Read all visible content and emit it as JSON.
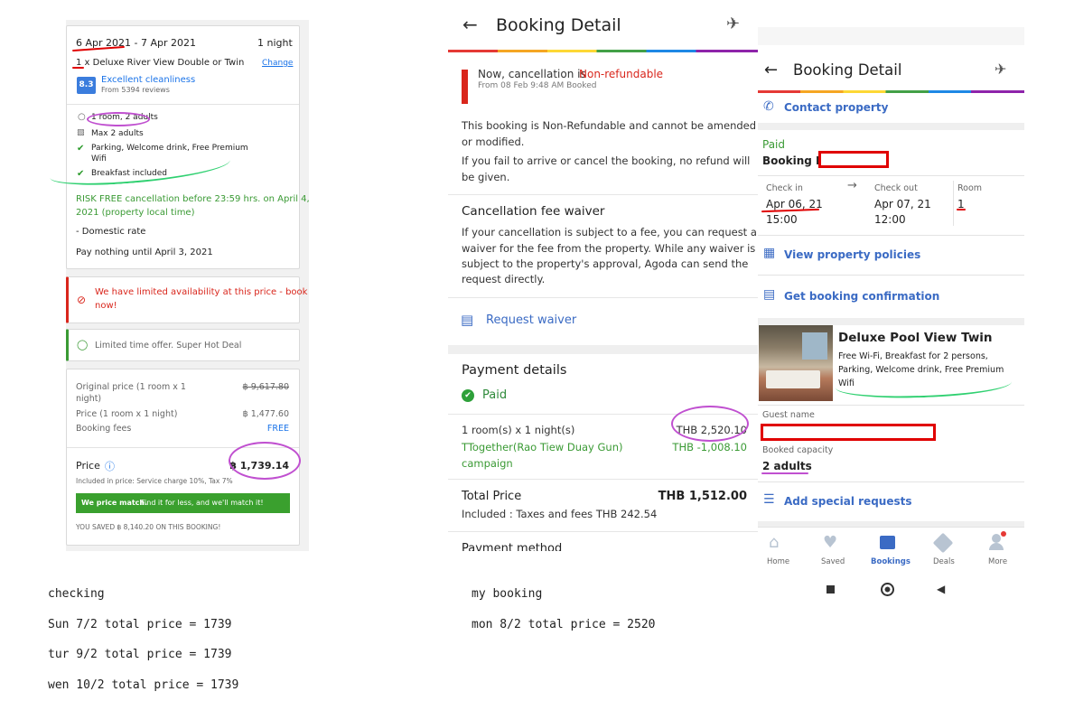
{
  "left": {
    "dates": "6 Apr 2021 - 7 Apr 2021",
    "nights": "1 night",
    "room_line": "1 x Deluxe River View Double or Twin",
    "change": "Change",
    "rating_score": "8.3",
    "rating_label": "Excellent cleanliness",
    "rating_reviews": "From 5394 reviews",
    "room_adults": "1 room, 2 adults",
    "max_adults": "Max 2 adults",
    "amenity1": "Parking, Welcome drink, Free Premium",
    "amenity1b": "Wifi",
    "amenity2": "Breakfast included",
    "cancel1": "RISK FREE cancellation before 23:59 hrs. on April 4,",
    "cancel2": "2021 (property local time)",
    "domestic": "- Domestic rate",
    "pay_nothing": "Pay nothing until April 3, 2021",
    "limited1": "We have limited availability at this price - book",
    "limited2": "now!",
    "offer": "Limited time offer. Super Hot Deal",
    "orig_label1": "Original price (1 room x 1",
    "orig_label2": "night)",
    "orig_value": "฿ 9,617.80",
    "price_label": "Price (1 room x 1 night)",
    "price_value": "฿ 1,477.60",
    "fees_label": "Booking fees",
    "fees_value": "FREE",
    "total_label": "Price",
    "total_value": "฿ 1,739.14",
    "included": "Included in price: Service charge 10%, Tax 7%",
    "match_bold": "We price match.",
    "match_rest": " Find it for less, and we'll match it!",
    "saved": "YOU SAVED ฿ 8,140.20 ON THIS BOOKING!"
  },
  "mid": {
    "title": "Booking Detail",
    "cancel_now": "Now, cancellation is ",
    "cancel_status": "Non-refundable",
    "cancel_from": "From 08 Feb 9:48 AM Booked",
    "nonref1": "This booking is Non-Refundable and cannot be amended",
    "nonref2": "or modified.",
    "nonref3": "If you fail to arrive or cancel the booking, no refund will",
    "nonref4": "be given.",
    "waiver_title": "Cancellation fee waiver",
    "waiver1": "If your cancellation is subject to a fee, you can request a",
    "waiver2": "waiver for the fee from the property. While any waiver is",
    "waiver3": "subject to the property's approval, Agoda can send the",
    "waiver4": "request directly.",
    "request_waiver": "Request waiver",
    "payment_title": "Payment details",
    "paid": "Paid",
    "room_nights": "1 room(s) x 1 night(s)",
    "room_price": "THB 2,520.10",
    "campaign1": "TTogether(Rao Tiew Duay Gun)",
    "campaign2": "campaign",
    "campaign_value": "THB -1,008.10",
    "total_label": "Total Price",
    "total_value": "THB 1,512.00",
    "taxes": "Included : Taxes and fees THB 242.54",
    "payment_method": "Payment method"
  },
  "right": {
    "title": "Booking Detail",
    "contact": "Contact property",
    "paid": "Paid",
    "booking_id": "Booking ID",
    "checkin_label": "Check in",
    "checkin_date": "Apr 06, 21",
    "checkin_time": "15:00",
    "checkout_label": "Check out",
    "checkout_date": "Apr 07, 21",
    "checkout_time": "12:00",
    "room_label": "Room",
    "room_count": "1",
    "policies": "View property policies",
    "confirmation": "Get booking confirmation",
    "room_name": "Deluxe Pool View Twin",
    "room_desc1": "Free Wi-Fi, Breakfast for 2 persons,",
    "room_desc2": "Parking, Welcome drink, Free Premium",
    "room_desc3": "Wifi",
    "guest_label": "Guest name",
    "capacity_label": "Booked capacity",
    "capacity_value": "2 adults",
    "special": "Add special requests",
    "nav": [
      "Home",
      "Saved",
      "Bookings",
      "Deals",
      "More"
    ]
  },
  "notes_left": {
    "heading": "checking",
    "l1": "Sun 7/2 total price = 1739",
    "l2": "tur 9/2  total price = 1739",
    "l3": "wen 10/2 total price = 1739"
  },
  "notes_mid": {
    "heading": "my booking",
    "l1": "mon 8/2 total price = 2520"
  },
  "colors": {
    "accent": "#3b6bc4",
    "green": "#3a9a34",
    "red": "#d9261c",
    "marker_red": "#e00000",
    "marker_pink": "#c050d0",
    "marker_green": "#2fd070"
  }
}
